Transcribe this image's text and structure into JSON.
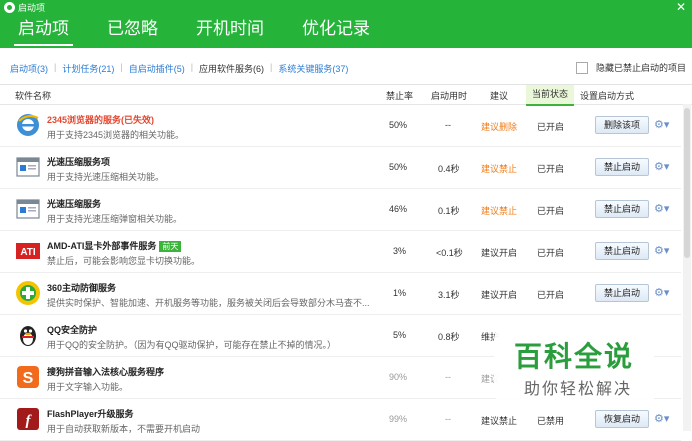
{
  "window": {
    "title": "启动项",
    "close": "✕"
  },
  "tabs": [
    {
      "label": "启动项"
    },
    {
      "label": "已忽略"
    },
    {
      "label": "开机时间"
    },
    {
      "label": "优化记录"
    }
  ],
  "subtabs": [
    {
      "label": "启动项(3)"
    },
    {
      "label": "计划任务(21)"
    },
    {
      "label": "自启动插件(5)"
    },
    {
      "label": "应用软件服务(6)"
    },
    {
      "label": "系统关键服务(37)"
    }
  ],
  "hide_option": "隐藏已禁止启动的项目",
  "columns": {
    "name": "软件名称",
    "ban_rate": "禁止率",
    "boot_time": "启动用时",
    "advice": "建议",
    "status": "当前状态",
    "setting": "设置启动方式"
  },
  "rows": [
    {
      "name": "2345浏览器的服务(已失效)",
      "desc": "用于支持2345浏览器的相关功能。",
      "ban_rate": "50%",
      "boot_time": "--",
      "advice": "建议删除",
      "status": "已开启",
      "action": "删除该项",
      "icon": "ie-browser-icon"
    },
    {
      "name": "光速压缩服务项",
      "desc": "用于支持光速压缩相关功能。",
      "ban_rate": "50%",
      "boot_time": "0.4秒",
      "advice": "建议禁止",
      "status": "已开启",
      "action": "禁止启动",
      "icon": "window-app-icon"
    },
    {
      "name": "光速压缩服务",
      "desc": "用于支持光速压缩弹窗相关功能。",
      "ban_rate": "46%",
      "boot_time": "0.1秒",
      "advice": "建议禁止",
      "status": "已开启",
      "action": "禁止启动",
      "icon": "window-app-icon"
    },
    {
      "name": "AMD-ATI显卡外部事件服务",
      "badge": "前天",
      "desc": "禁止后，可能会影响您显卡切换功能。",
      "ban_rate": "3%",
      "boot_time": "<0.1秒",
      "advice": "建议开启",
      "status": "已开启",
      "action": "禁止启动",
      "icon": "ati-logo-icon"
    },
    {
      "name": "360主动防御服务",
      "desc": "提供实时保护、智能加速、开机服务等功能，服务被关闭后会导致部分木马查不...",
      "ban_rate": "1%",
      "boot_time": "3.1秒",
      "advice": "建议开启",
      "status": "已开启",
      "action": "禁止启动",
      "icon": "360-shield-icon"
    },
    {
      "name": "QQ安全防护",
      "desc": "用于QQ的安全防护。（因为有QQ驱动保护，可能存在禁止不掉的情况。）",
      "ban_rate": "5%",
      "boot_time": "0.8秒",
      "advice": "维护",
      "status": "",
      "action": "",
      "icon": "qq-penguin-icon"
    },
    {
      "name": "搜狗拼音输入法核心服务程序",
      "desc": "用于文字输入功能。",
      "ban_rate": "90%",
      "boot_time": "--",
      "advice": "建议",
      "status": "",
      "action": "",
      "icon": "sogou-icon"
    },
    {
      "name": "FlashPlayer升级服务",
      "desc": "用于自动获取新版本，不需要开机启动",
      "ban_rate": "99%",
      "boot_time": "--",
      "advice": "建议禁止",
      "status": "已禁用",
      "action": "恢复启动",
      "icon": "flash-icon"
    }
  ],
  "watermark": {
    "top": "百科全说",
    "bottom": "助你轻松解决"
  },
  "colors": {
    "brand_green": "#25b33a",
    "link_blue": "#2a7bd6",
    "advice_orange": "#ef7d17",
    "title_red": "#e5462e"
  }
}
